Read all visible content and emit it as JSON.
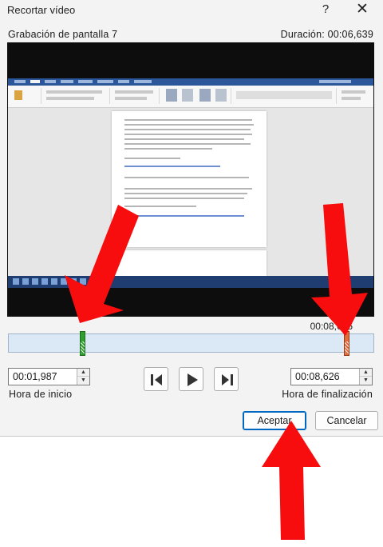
{
  "window": {
    "title": "Recortar vídeo",
    "help_label": "?",
    "close_label": "✕"
  },
  "video": {
    "name": "Grabación de pantalla 7",
    "duration": "Duración: 00:06,639"
  },
  "timeline": {
    "end_marker_time": "00:08,626"
  },
  "start_time": {
    "value": "00:01,987",
    "label": "Hora de inicio"
  },
  "end_time": {
    "value": "00:08,626",
    "label": "Hora de finalización"
  },
  "playback": {
    "previous_frame_icon": "previous-frame-icon",
    "play_icon": "play-icon",
    "next_frame_icon": "next-frame-icon"
  },
  "buttons": {
    "ok_label": "Aceptar",
    "cancel_label": "Cancelar"
  },
  "colors": {
    "start_handle": "#2fa02f",
    "end_handle": "#e06a3a",
    "timeline_fill": "#dbe9f7",
    "annotation_arrow": "#f70d0d",
    "primary_border": "#0067c0"
  }
}
